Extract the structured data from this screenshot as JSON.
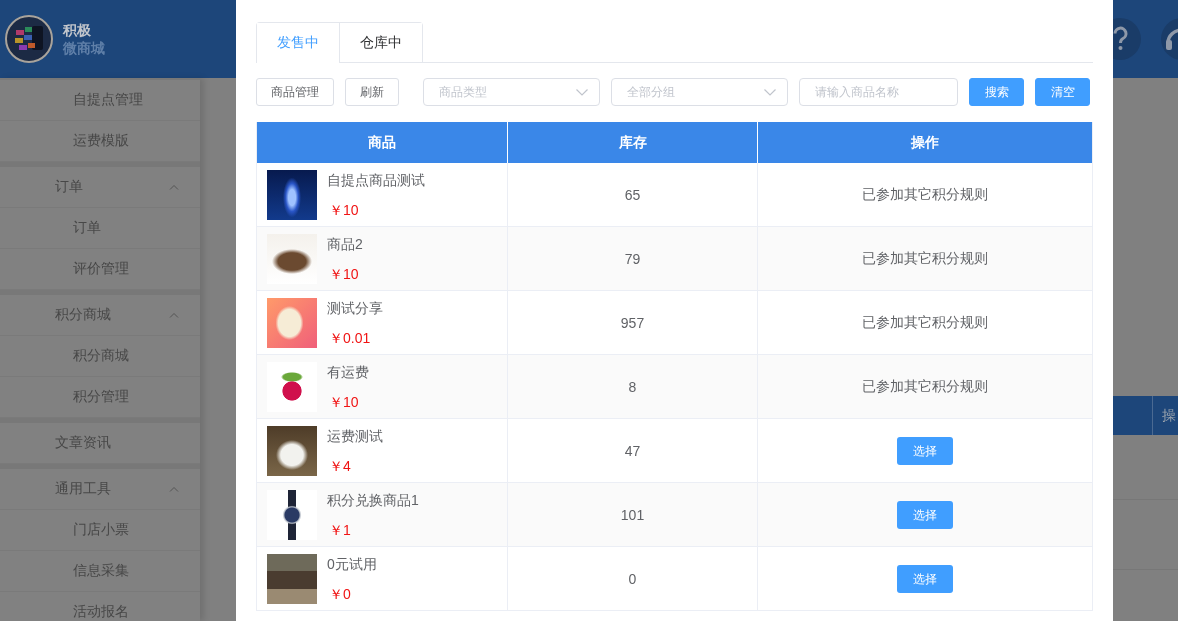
{
  "header": {
    "brand_name": "积极",
    "brand_subtitle": "微商城"
  },
  "sidebar": {
    "sections": [
      {
        "kind": "continued",
        "children": [
          {
            "label": "自提点管理"
          },
          {
            "label": "运费模版"
          }
        ]
      },
      {
        "kind": "group",
        "label": "订单",
        "expanded": true,
        "children": [
          {
            "label": "订单"
          },
          {
            "label": "评价管理"
          }
        ]
      },
      {
        "kind": "group",
        "label": "积分商城",
        "expanded": true,
        "children": [
          {
            "label": "积分商城"
          },
          {
            "label": "积分管理"
          }
        ]
      },
      {
        "kind": "link",
        "label": "文章资讯"
      },
      {
        "kind": "group",
        "label": "通用工具",
        "expanded": true,
        "children": [
          {
            "label": "门店小票"
          },
          {
            "label": "信息采集"
          },
          {
            "label": "活动报名"
          }
        ]
      }
    ]
  },
  "background_table": {
    "column_header": "操"
  },
  "modal": {
    "tabs": [
      {
        "label": "发售中",
        "selected": true
      },
      {
        "label": "仓库中",
        "selected": false
      }
    ],
    "toolbar": [
      {
        "kind": "button",
        "label": "商品管理"
      },
      {
        "kind": "button",
        "label": "刷新"
      },
      {
        "kind": "select",
        "placeholder": "商品类型"
      },
      {
        "kind": "select",
        "placeholder": "全部分组"
      },
      {
        "kind": "input",
        "placeholder": "请输入商品名称"
      },
      {
        "kind": "primary",
        "label": "搜索"
      },
      {
        "kind": "primary",
        "label": "清空"
      }
    ],
    "table": {
      "columns": [
        "商品",
        "库存",
        "操作"
      ],
      "rows": [
        {
          "name": "自提点商品测试",
          "price": "￥10",
          "stock": "65",
          "action": {
            "kind": "note",
            "text": "已参加其它积分规则"
          }
        },
        {
          "name": "商品2",
          "price": "￥10",
          "stock": "79",
          "action": {
            "kind": "note",
            "text": "已参加其它积分规则"
          }
        },
        {
          "name": "测试分享",
          "price": "￥0.01",
          "stock": "957",
          "action": {
            "kind": "note",
            "text": "已参加其它积分规则"
          }
        },
        {
          "name": "有运费",
          "price": "￥10",
          "stock": "8",
          "action": {
            "kind": "note",
            "text": "已参加其它积分规则"
          }
        },
        {
          "name": "运费测试",
          "price": "￥4",
          "stock": "47",
          "action": {
            "kind": "button",
            "label": "选择"
          }
        },
        {
          "name": "积分兑换商品1",
          "price": "￥1",
          "stock": "101",
          "action": {
            "kind": "button",
            "label": "选择"
          }
        },
        {
          "name": "0元试用",
          "price": "￥0",
          "stock": "0",
          "action": {
            "kind": "button",
            "label": "选择"
          }
        }
      ]
    }
  }
}
